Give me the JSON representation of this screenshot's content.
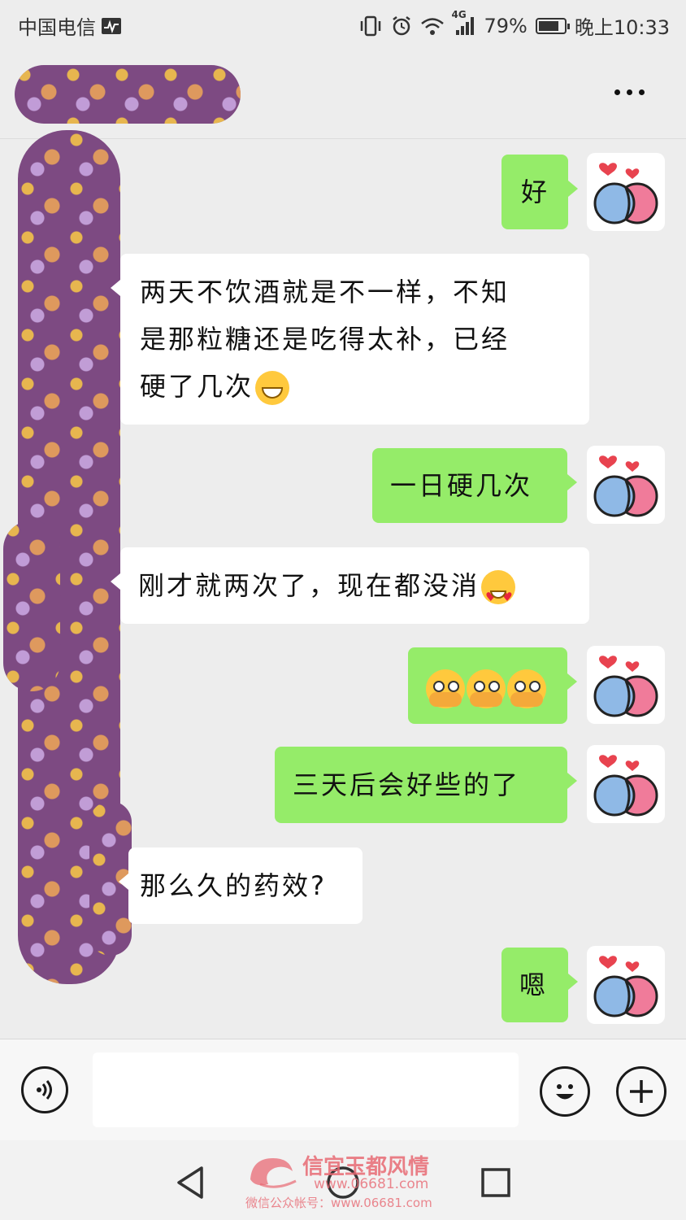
{
  "status_bar": {
    "carrier": "中国电信",
    "network": "4G",
    "battery": "79%",
    "battery_level": 0.79,
    "time": "晚上10:33"
  },
  "chat": {
    "messages": [
      {
        "side": "out",
        "text": "好"
      },
      {
        "side": "in",
        "lines": [
          "两天不饮酒就是不一样，不知",
          "是那粒糖还是吃得太补，已经",
          "硬了几次"
        ],
        "emoji": "grinning-face"
      },
      {
        "side": "out",
        "text": "一日硬几次"
      },
      {
        "side": "in",
        "text": "刚才就两次了，现在都没消",
        "emoji": "heart-eyes-face"
      },
      {
        "side": "out",
        "emoji": "peeking-face",
        "emoji_count": 3
      },
      {
        "side": "out",
        "text": "三天后会好些的了"
      },
      {
        "side": "in",
        "text": "那么久的药效?"
      },
      {
        "side": "out",
        "text": "嗯"
      }
    ]
  },
  "input_bar": {
    "value": ""
  },
  "watermark": {
    "title": "信宜玉都风情",
    "url": "www.06681.com",
    "subtitle": "微信公众帐号：www.06681.com"
  },
  "colors": {
    "outgoing_bubble": "#95ec69",
    "incoming_bubble": "#ffffff",
    "background": "#ededed"
  }
}
